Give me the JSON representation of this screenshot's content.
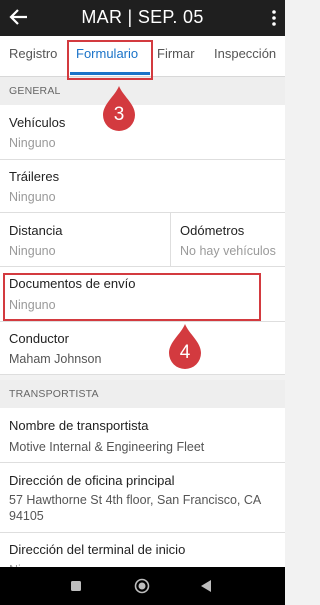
{
  "appbar": {
    "title": "MAR | SEP. 05"
  },
  "tabs": [
    {
      "label": "Registro"
    },
    {
      "label": "Formulario"
    },
    {
      "label": "Firmar"
    },
    {
      "label": "Inspección"
    }
  ],
  "callouts": {
    "tab": "3",
    "shipping": "4"
  },
  "sections": {
    "general": "GENERAL",
    "carrier": "TRANSPORTISTA"
  },
  "fields": {
    "vehicles": {
      "label": "Vehículos",
      "value": "Ninguno"
    },
    "trailers": {
      "label": "Tráileres",
      "value": "Ninguno"
    },
    "distance": {
      "label": "Distancia",
      "value": "Ninguno"
    },
    "odometers": {
      "label": "Odómetros",
      "value": "No hay vehículos"
    },
    "shipping_docs": {
      "label": "Documentos de envío",
      "value": "Ninguno"
    },
    "driver": {
      "label": "Conductor",
      "value": "Maham Johnson"
    },
    "carrier_name": {
      "label": "Nombre de transportista",
      "value": "Motive Internal & Engineering Fleet"
    },
    "main_office": {
      "label": "Dirección de oficina principal",
      "value_line1": "57 Hawthorne St 4th floor, San Francisco, CA",
      "value_line2": "94105"
    },
    "home_terminal": {
      "label": "Dirección del terminal de inicio",
      "value": "Ninguno"
    }
  },
  "colors": {
    "accent": "#1a73c8",
    "annotation": "#d33a3f",
    "appbar": "#1f1f1f"
  },
  "icons": [
    "back-arrow-icon",
    "more-vertical-icon",
    "nav-square-icon",
    "nav-circle-icon",
    "nav-back-icon"
  ]
}
